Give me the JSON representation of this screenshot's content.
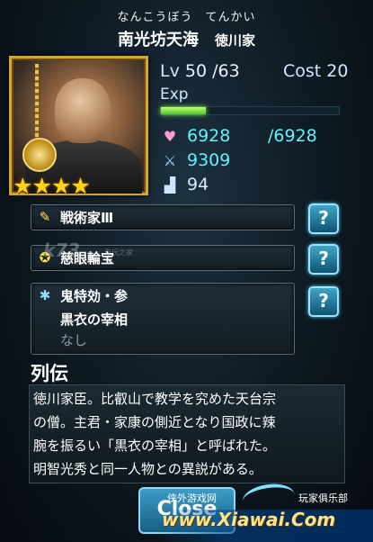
{
  "header": {
    "ruby": "なんこうぼう　てんかい",
    "name": "南光坊天海",
    "clan": "徳川家"
  },
  "card": {
    "stars": "★★★★",
    "star_count": 4
  },
  "stats": {
    "lv_label": "Lv",
    "lv_value": "50 /63",
    "cost_label": "Cost",
    "cost_value": "20",
    "exp_label": "Exp",
    "exp_fraction": 0.25,
    "hp_icon": "heart-icon",
    "hp_value": "6928",
    "hp_max": "/6928",
    "atk_icon": "sword-icon",
    "atk_value": "9309",
    "spd_icon": "boot-icon",
    "spd_value": "94"
  },
  "skills": [
    {
      "icon": "tactician-icon",
      "label": "戦術家Ⅲ"
    },
    {
      "icon": "treasure-icon",
      "label": "慈眼輪宝"
    },
    {
      "icon": "special-attack-icon",
      "label": "鬼特効・参",
      "line2": "黒衣の宰相",
      "line3": "なし"
    }
  ],
  "help_button": "?",
  "bio": {
    "title": "列伝",
    "lines": [
      "徳川家臣。比叡山で教学を究めた天台宗",
      "の僧。主君・家康の側近となり国政に辣",
      "腕を振るい「黒衣の宰相」と呼ばれた。",
      "明智光秀と同一人物との異説がある。"
    ]
  },
  "close_button": "Close",
  "watermark": {
    "k73": "k73",
    "k73_cn": "电玩之家",
    "k73_url": ".com",
    "xiawai": "www.Xiawai.Com",
    "xiawai_left": "侠外游戏网",
    "xiawai_right": "玩家俱乐部"
  },
  "colors": {
    "stat_cyan": "#5ef3ff",
    "gold_border": "#d7a72d",
    "exp_green": "#7dff55"
  }
}
